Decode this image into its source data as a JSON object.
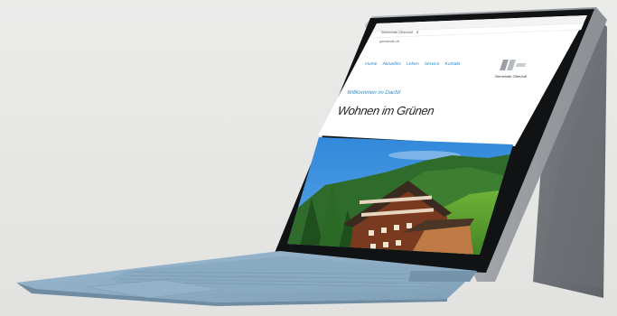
{
  "scene": {
    "device": "detachable tablet with keyboard cover",
    "keyboard_color": "#8fb0c8",
    "frame_color": "#9a9ea3"
  },
  "browser": {
    "tab_title": "Gemeinde Oberzwil · ✕",
    "address": "gemeinde.ch"
  },
  "website": {
    "nav": [
      "Home",
      "Aktuelles",
      "Leben",
      "Service",
      "Kontakt"
    ],
    "brand_name": "Gemeinde Oberzwil",
    "welcome": "Willkommen im Dachli",
    "headline": "Wohnen im Grünen"
  },
  "colors": {
    "accent": "#2a8bc7",
    "sky": "#3f8fd6",
    "forest": "#2f6b2a",
    "chalet_wood": "#7a3a1f"
  }
}
